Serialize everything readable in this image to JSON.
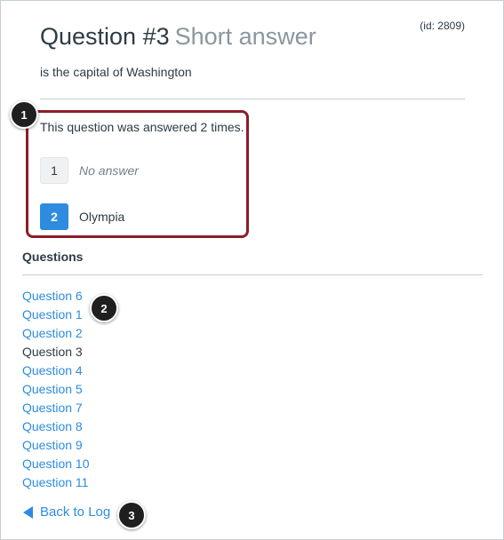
{
  "question": {
    "title": "Question #3",
    "type": "Short answer",
    "id_label": "(id: 2809)",
    "text": "is the capital of Washington"
  },
  "answers": {
    "summary": "This question was answered 2 times.",
    "items": [
      {
        "number": "1",
        "text": "No answer"
      },
      {
        "number": "2",
        "text": "Olympia"
      }
    ]
  },
  "questions_section": {
    "heading": "Questions",
    "items": [
      {
        "label": "Question 6"
      },
      {
        "label": "Question 1"
      },
      {
        "label": "Question 2"
      },
      {
        "label": "Question 3"
      },
      {
        "label": "Question 4"
      },
      {
        "label": "Question 5"
      },
      {
        "label": "Question 7"
      },
      {
        "label": "Question 8"
      },
      {
        "label": "Question 9"
      },
      {
        "label": "Question 10"
      },
      {
        "label": "Question 11"
      }
    ]
  },
  "back_link": "Back to Log",
  "callouts": [
    "1",
    "2",
    "3"
  ],
  "colors": {
    "link": "#2d8ce0",
    "highlight_border": "#8b1e28",
    "callout": "#1f1f1f"
  }
}
